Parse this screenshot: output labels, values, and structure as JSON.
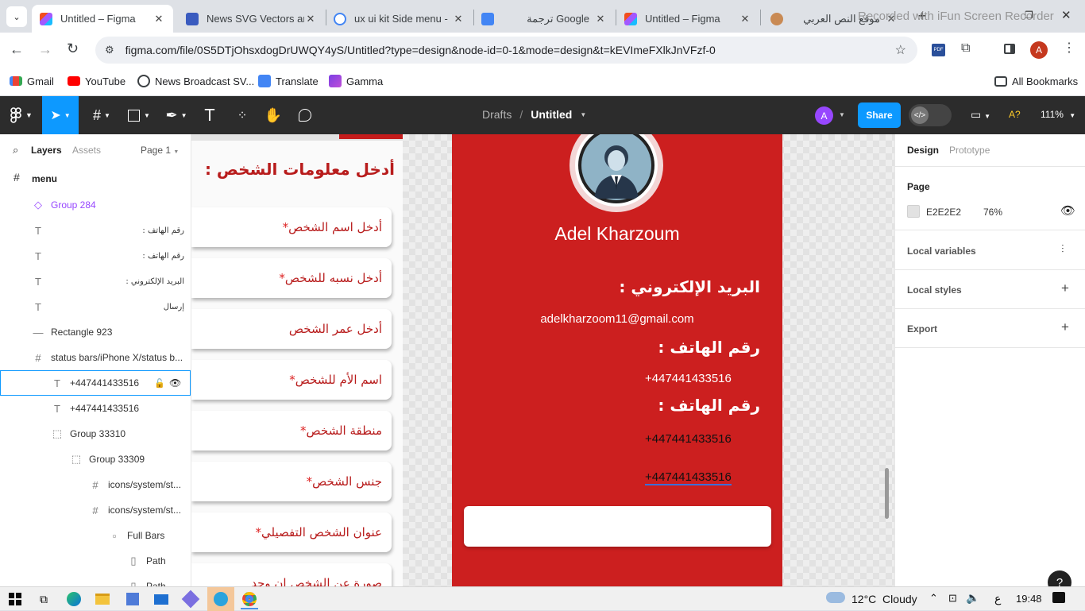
{
  "browser": {
    "tabs": [
      {
        "title": "Untitled – Figma",
        "active": true
      },
      {
        "title": "News SVG Vectors an"
      },
      {
        "title": "ux ui kit Side menu -"
      },
      {
        "title": "ترجمة Google"
      },
      {
        "title": "Untitled – Figma"
      },
      {
        "title": "موقع النص العربي"
      }
    ],
    "new_tab": "+",
    "recorder_watermark": "Recorded with iFun Screen Recorder",
    "url": "figma.com/file/0S5DTjOhsxdogDrUWQY4yS/Untitled?type=design&node-id=0-1&mode=design&t=kEVImeFXlkJnVFzf-0",
    "profile_initial": "A",
    "bookmarks": [
      "Gmail",
      "YouTube",
      "News Broadcast SV...",
      "Translate",
      "Gamma"
    ],
    "all_bookmarks": "All Bookmarks"
  },
  "figma": {
    "breadcrumb": {
      "folder": "Drafts",
      "separator": "/",
      "file": "Untitled"
    },
    "avatar_initial": "A",
    "share_label": "Share",
    "zoom": "111%",
    "left_panel": {
      "tabs": {
        "layers": "Layers",
        "assets": "Assets",
        "page": "Page 1"
      },
      "root": "menu",
      "layers": [
        {
          "name": "Group 284",
          "icon": "◇",
          "kind": "component"
        },
        {
          "name": "رقم الهاتف :",
          "icon": "T",
          "kind": "text-rtl"
        },
        {
          "name": "رقم الهاتف :",
          "icon": "T",
          "kind": "text-rtl"
        },
        {
          "name": "البريد الإلكتروني :",
          "icon": "T",
          "kind": "text-rtl"
        },
        {
          "name": "إرسال",
          "icon": "T",
          "kind": "text-rtl"
        },
        {
          "name": "Rectangle 923",
          "icon": "—",
          "kind": "rect"
        },
        {
          "name": "status bars/iPhone X/status b...",
          "icon": "#",
          "kind": "frame"
        },
        {
          "name": "+447441433516",
          "icon": "T",
          "kind": "selected"
        },
        {
          "name": "+447441433516",
          "icon": "T",
          "kind": "text"
        },
        {
          "name": "Group 33310",
          "icon": "⬚",
          "kind": "group"
        },
        {
          "name": "Group 33309",
          "icon": "⬚",
          "kind": "group"
        },
        {
          "name": "icons/system/st...",
          "icon": "#",
          "kind": "frame"
        },
        {
          "name": "icons/system/st...",
          "icon": "#",
          "kind": "frame"
        },
        {
          "name": "Full Bars",
          "icon": "▫",
          "kind": "vector"
        },
        {
          "name": "Path",
          "icon": "▯",
          "kind": "vector"
        },
        {
          "name": "Path",
          "icon": "▯",
          "kind": "vector"
        }
      ]
    },
    "canvas": {
      "form_title": "أدخل معلومات الشخص :",
      "fields": [
        {
          "label": "أدخل اسم الشخص",
          "required": true
        },
        {
          "label": "أدخل نسبه للشخص",
          "required": true
        },
        {
          "label": "أدخل عمر الشخص",
          "required": false
        },
        {
          "label": "اسم الأم للشخص",
          "required": true
        },
        {
          "label": "منطقة الشخص",
          "required": true
        },
        {
          "label": "جنس الشخص",
          "required": true
        },
        {
          "label": "عنوان الشخص التفصيلي",
          "required": true
        },
        {
          "label": "صورة عن الشخص ان وجد",
          "required": false
        }
      ],
      "required_mark": "*",
      "profile": {
        "name": "Adel Kharzoum",
        "email_heading": "البريد الإلكتروني :",
        "email": "adelkharzoom11@gmail.com",
        "phone_heading": "رقم الهاتف :",
        "phone1": "+447441433516",
        "phone_heading2": "رقم الهاتف :",
        "phone2": "+447441433516",
        "phone3": "+447441433516"
      },
      "card_color": "#cc1f1f"
    },
    "right_panel": {
      "tabs": {
        "design": "Design",
        "prototype": "Prototype"
      },
      "page_heading": "Page",
      "page_color_hex": "E2E2E2",
      "page_color_opacity": "76%",
      "sections": [
        "Local variables",
        "Local styles",
        "Export"
      ],
      "help": "?"
    }
  },
  "taskbar": {
    "weather": "12°C  Cloudy",
    "lang": "ع",
    "time": "19:48"
  }
}
